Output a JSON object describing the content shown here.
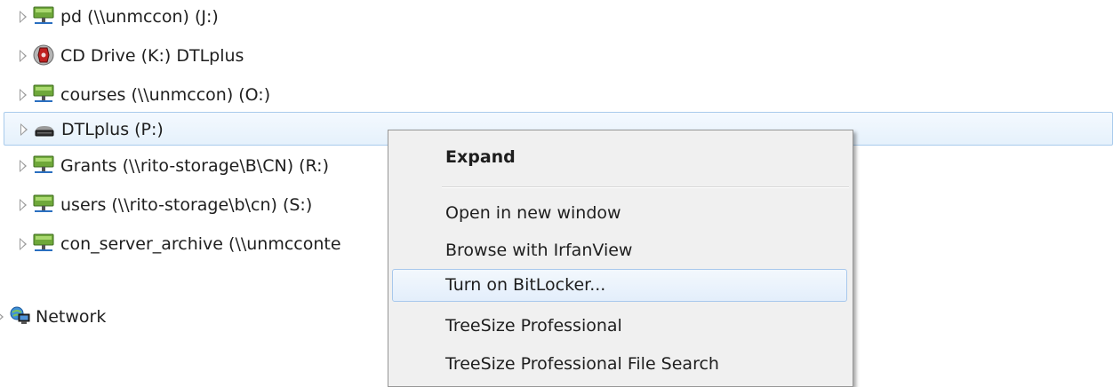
{
  "tree": {
    "items": [
      {
        "label": "pd (\\\\unmccon) (J:)",
        "icon": "network-drive-icon"
      },
      {
        "label": "CD Drive (K:) DTLplus",
        "icon": "cd-drive-icon"
      },
      {
        "label": "courses (\\\\unmccon) (O:)",
        "icon": "network-drive-icon"
      },
      {
        "label": "DTLplus (P:)",
        "icon": "removable-drive-icon",
        "selected": true
      },
      {
        "label": "Grants (\\\\rito-storage\\B\\CN) (R:)",
        "icon": "network-drive-icon"
      },
      {
        "label": "users (\\\\rito-storage\\b\\cn) (S:)",
        "icon": "network-drive-icon"
      },
      {
        "label": "con_server_archive (\\\\unmcconte",
        "icon": "network-drive-icon"
      }
    ],
    "network": {
      "label": "Network",
      "icon": "network-icon"
    }
  },
  "context_menu": {
    "items": [
      {
        "label": "Expand",
        "bold": true
      },
      {
        "label": "Open in new window"
      },
      {
        "label": "Browse with IrfanView"
      },
      {
        "label": "Turn on BitLocker...",
        "hover": true
      },
      {
        "label": "TreeSize Professional"
      },
      {
        "label": "TreeSize Professional File Search"
      }
    ]
  },
  "colors": {
    "selection_border": "#a9cbec",
    "menu_background": "#f0f0f0",
    "menu_border": "#979797"
  }
}
